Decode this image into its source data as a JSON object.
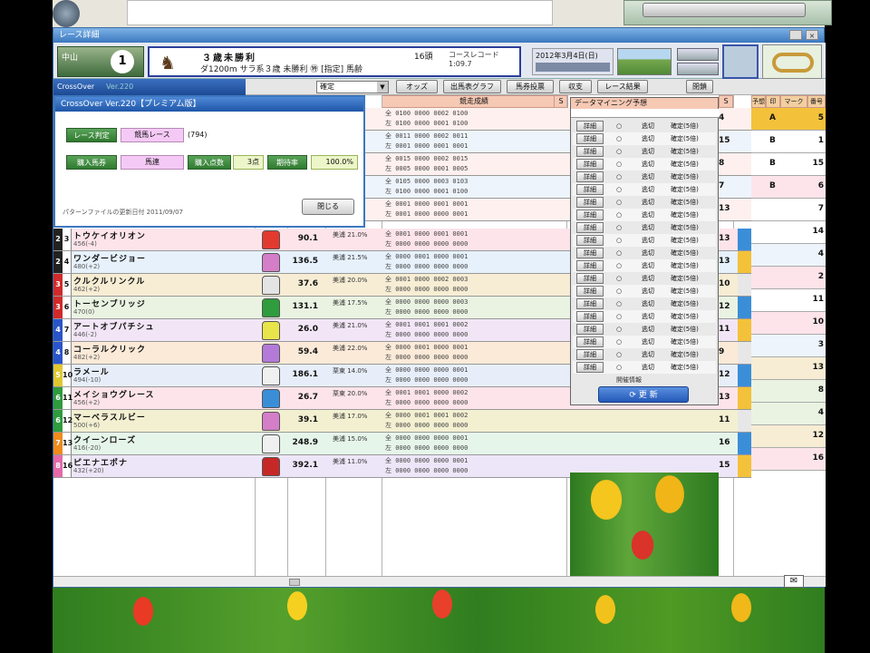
{
  "window": {
    "title": "レース詳細",
    "close_label": "×"
  },
  "header": {
    "venue": "中山",
    "race_no": "1",
    "race_name": "３歳未勝利",
    "count": "16頭",
    "record": "コースレコード 1:09.7",
    "condition": "ダ1200m サラ系３歳 未勝利 ㊕ [指定] 馬齢",
    "date": "2012年3月4日(日)",
    "icon": "horse-icon"
  },
  "toolbar": {
    "app": "CrossOver",
    "version": "Ver.220",
    "combo_value": "確定",
    "buttons": [
      "オッズ",
      "出馬表グラフ",
      "馬券投票",
      "収支",
      "レース結果",
      "閉鎖"
    ]
  },
  "grid_headers": {
    "record": "競走成績",
    "dm": "データマイニング予想",
    "s1": "S",
    "s2": "S",
    "r1": "予想",
    "r2": "印",
    "r3": "マーク",
    "r4": "番号"
  },
  "dialog": {
    "title": "CrossOver Ver.220【プレミアム版】",
    "label_judge": "レース判定",
    "value_judge": "競馬レース",
    "code": "(794)",
    "label_type": "購入馬券",
    "value_type": "馬連",
    "label_points": "購入点数",
    "value_points": "3点",
    "label_rate": "期待率",
    "value_rate": "100.0%",
    "note": "パターンファイルの更新日付  2011/09/07",
    "close": "閉じる"
  },
  "rows": [
    {
      "wk": "2",
      "hn": "3",
      "name": "トウケイオリオン",
      "sub": "456(-4)",
      "odds": "90.1",
      "jk": "美浦 21.0%",
      "rec": [
        "全 0001 0000 0001 0001",
        "左 0000 0000 0000 0000"
      ],
      "rnum": "13",
      "wkcolor": "#222",
      "silk": "#e23a2e"
    },
    {
      "wk": "2",
      "hn": "4",
      "name": "ワンダービジョー",
      "sub": "480(+2)",
      "odds": "136.5",
      "jk": "美浦 21.5%",
      "rec": [
        "全 0000 0001 0000 0001",
        "左 0000 0000 0000 0000"
      ],
      "rnum": "13",
      "wkcolor": "#222",
      "silk": "#d47ec8"
    },
    {
      "wk": "3",
      "hn": "5",
      "name": "クルクルリンクル",
      "sub": "462(+2)",
      "odds": "37.6",
      "jk": "美浦 20.0%",
      "rec": [
        "全 0001 0000 0002 0003",
        "左 0000 0000 0000 0000"
      ],
      "rnum": "10",
      "wkcolor": "#d12a2a",
      "silk": "#e4e4e4"
    },
    {
      "wk": "3",
      "hn": "6",
      "name": "トーセンブリッジ",
      "sub": "470(0)",
      "odds": "131.1",
      "jk": "美浦 17.5%",
      "rec": [
        "全 0000 0000 0000 0003",
        "左 0000 0000 0000 0000"
      ],
      "rnum": "12",
      "wkcolor": "#d12a2a",
      "silk": "#2f9c3d"
    },
    {
      "wk": "4",
      "hn": "7",
      "name": "アートオブパチシュ",
      "sub": "446(-2)",
      "odds": "26.0",
      "jk": "美浦 21.0%",
      "rec": [
        "全 0001 0001 0001 0002",
        "左 0000 0000 0000 0000"
      ],
      "rnum": "11",
      "wkcolor": "#2a55c9",
      "silk": "#e8e54a"
    },
    {
      "wk": "4",
      "hn": "8",
      "name": "コーラルクリック",
      "sub": "482(+2)",
      "odds": "59.4",
      "jk": "美浦 22.0%",
      "rec": [
        "全 0000 0001 0000 0001",
        "左 0000 0000 0000 0000"
      ],
      "rnum": "9",
      "wkcolor": "#2a55c9",
      "silk": "#b47ad9"
    },
    {
      "wk": "5",
      "hn": "10",
      "name": "ラメール",
      "sub": "494(-10)",
      "odds": "186.1",
      "jk": "栗東 14.0%",
      "rec": [
        "全 0000 0000 0000 0001",
        "左 0000 0000 0000 0000"
      ],
      "rnum": "12",
      "wkcolor": "#e0c830",
      "silk": "#f0f0f0"
    },
    {
      "wk": "6",
      "hn": "11",
      "name": "メイショウグレース",
      "sub": "456(+2)",
      "odds": "26.7",
      "jk": "栗東 20.0%",
      "rec": [
        "全 0001 0001 0000 0002",
        "左 0000 0000 0000 0000"
      ],
      "rnum": "13",
      "wkcolor": "#2f9c3d",
      "silk": "#3a8ed8"
    },
    {
      "wk": "6",
      "hn": "12",
      "name": "マーベラスルビー",
      "sub": "500(+6)",
      "odds": "39.1",
      "jk": "美浦 17.0%",
      "rec": [
        "全 0000 0001 0001 0002",
        "左 0000 0000 0000 0000"
      ],
      "rnum": "11",
      "wkcolor": "#2f9c3d",
      "silk": "#d47ec8"
    },
    {
      "wk": "7",
      "hn": "13",
      "name": "クイーンローズ",
      "sub": "416(-20)",
      "odds": "248.9",
      "jk": "美浦 15.0%",
      "rec": [
        "全 0000 0000 0000 0001",
        "左 0000 0000 0000 0000"
      ],
      "rnum": "16",
      "wkcolor": "#f08a1c",
      "silk": "#f0f0f0"
    },
    {
      "wk": "8",
      "hn": "16",
      "name": "ピエナエポナ",
      "sub": "432(+20)",
      "odds": "392.1",
      "jk": "美浦 11.0%",
      "rec": [
        "全 0000 0000 0000 0001",
        "左 0000 0000 0000 0000"
      ],
      "rnum": "15",
      "wkcolor": "#e56aa9",
      "silk": "#c62828"
    }
  ],
  "rows_top": [
    {
      "rec": [
        "全 0100 0000 0002 0100",
        "左 0100 0000 0001 0100"
      ],
      "rnum": "4"
    },
    {
      "rec": [
        "全 0011 0000 0002 0011",
        "左 0001 0000 0001 0001"
      ],
      "rnum": "15"
    },
    {
      "rec": [
        "全 0015 0000 0002 0015",
        "左 0005 0000 0001 0005"
      ],
      "rnum": "8"
    },
    {
      "rec": [
        "全 0105 0000 0003 0103",
        "左 0100 0000 0001 0100"
      ],
      "rnum": "7"
    },
    {
      "rec": [
        "全 0001 0000 0001 0001",
        "左 0001 0000 0000 0001"
      ],
      "rnum": "13"
    }
  ],
  "dm": {
    "rows": [
      {
        "btn": "詳細",
        "o": "○",
        "t1": "逃切",
        "t2": "確定(5倍)"
      },
      {
        "btn": "詳細",
        "o": "○",
        "t1": "逃切",
        "t2": "確定(5倍)"
      },
      {
        "btn": "詳細",
        "o": "○",
        "t1": "逃切",
        "t2": "確定(5倍)"
      },
      {
        "btn": "詳細",
        "o": "○",
        "t1": "逃切",
        "t2": "確定(5倍)"
      },
      {
        "btn": "詳細",
        "o": "○",
        "t1": "逃切",
        "t2": "確定(5倍)"
      },
      {
        "btn": "詳細",
        "o": "○",
        "t1": "逃切",
        "t2": "確定(5倍)"
      },
      {
        "btn": "詳細",
        "o": "○",
        "t1": "逃切",
        "t2": "確定(5倍)"
      },
      {
        "btn": "詳細",
        "o": "○",
        "t1": "逃切",
        "t2": "確定(5倍)"
      },
      {
        "btn": "詳細",
        "o": "○",
        "t1": "逃切",
        "t2": "確定(5倍)"
      },
      {
        "btn": "詳細",
        "o": "○",
        "t1": "逃切",
        "t2": "確定(5倍)"
      },
      {
        "btn": "詳細",
        "o": "○",
        "t1": "逃切",
        "t2": "確定(5倍)"
      },
      {
        "btn": "詳細",
        "o": "○",
        "t1": "逃切",
        "t2": "確定(5倍)"
      },
      {
        "btn": "詳細",
        "o": "○",
        "t1": "逃切",
        "t2": "確定(5倍)"
      },
      {
        "btn": "詳細",
        "o": "○",
        "t1": "逃切",
        "t2": "確定(5倍)"
      },
      {
        "btn": "詳細",
        "o": "○",
        "t1": "逃切",
        "t2": "確定(5倍)"
      },
      {
        "btn": "詳細",
        "o": "○",
        "t1": "逃切",
        "t2": "確定(5倍)"
      },
      {
        "btn": "詳細",
        "o": "○",
        "t1": "逃切",
        "t2": "確定(5倍)"
      },
      {
        "btn": "詳細",
        "o": "○",
        "t1": "逃切",
        "t2": "確定(5倍)"
      },
      {
        "btn": "詳細",
        "o": "○",
        "t1": "逃切",
        "t2": "確定(5倍)"
      },
      {
        "btn": "詳細",
        "o": "○",
        "t1": "逃切",
        "t2": "確定(5倍)"
      }
    ],
    "update_label": "開催情報",
    "update_btn": "更 新"
  },
  "right": [
    {
      "mk": "A",
      "num": "5"
    },
    {
      "mk": "B",
      "num": "1"
    },
    {
      "mk": "B",
      "num": "15"
    },
    {
      "mk": "B",
      "num": "6"
    },
    {
      "mk": "",
      "num": "7"
    },
    {
      "mk": "",
      "num": "14"
    },
    {
      "mk": "",
      "num": "4"
    },
    {
      "mk": "",
      "num": "2"
    },
    {
      "mk": "",
      "num": "11"
    },
    {
      "mk": "",
      "num": "10"
    },
    {
      "mk": "",
      "num": "3"
    },
    {
      "mk": "",
      "num": "13"
    },
    {
      "mk": "",
      "num": "8"
    },
    {
      "mk": "",
      "num": "4"
    },
    {
      "mk": "",
      "num": "12"
    },
    {
      "mk": "",
      "num": "16"
    }
  ],
  "mail_icon": "mail-icon"
}
